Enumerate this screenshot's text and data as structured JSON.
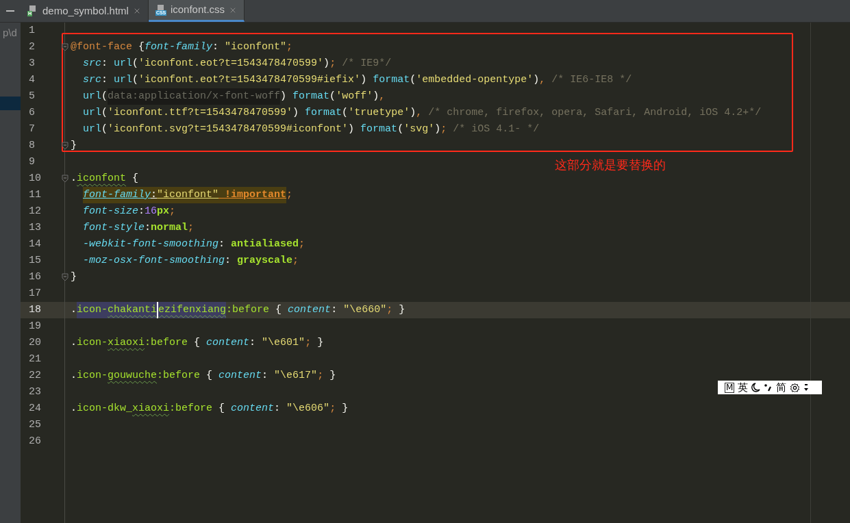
{
  "tabs": [
    {
      "label": "demo_symbol.html",
      "badge": "H",
      "color": "#499c54",
      "selected": false
    },
    {
      "label": "iconfont.css",
      "badge": "CSS",
      "color": "#3592c4",
      "selected": true
    }
  ],
  "sidebar": {
    "path_fragment": "p\\d"
  },
  "editor": {
    "lines": [
      {
        "number": "1",
        "kind": "top",
        "current": false
      },
      {
        "number": "2",
        "kind": "top",
        "current": false,
        "fold": true,
        "tokens": [
          {
            "text": "@font-face",
            "kind": "atrule"
          },
          {
            "text": " {",
            "kind": "punct"
          },
          {
            "text": "font-family",
            "kind": "prop"
          },
          {
            "text": ": ",
            "kind": "punct"
          },
          {
            "text": "\"iconfont\"",
            "kind": "str"
          },
          {
            "text": ";",
            "kind": "semi"
          }
        ]
      },
      {
        "number": "3",
        "kind": "body",
        "current": false,
        "tokens": [
          {
            "text": "src",
            "kind": "prop"
          },
          {
            "text": ": ",
            "kind": "punct"
          },
          {
            "text": "url",
            "kind": "func"
          },
          {
            "text": "(",
            "kind": "punct"
          },
          {
            "text": "'iconfont.eot?t=1543478470599'",
            "kind": "str"
          },
          {
            "text": ")",
            "kind": "punct"
          },
          {
            "text": ";",
            "kind": "semi"
          },
          {
            "text": " /* IE9*/",
            "kind": "comment"
          }
        ]
      },
      {
        "number": "4",
        "kind": "body",
        "current": false,
        "tokens": [
          {
            "text": "src",
            "kind": "prop"
          },
          {
            "text": ": ",
            "kind": "punct"
          },
          {
            "text": "url",
            "kind": "func"
          },
          {
            "text": "(",
            "kind": "punct"
          },
          {
            "text": "'iconfont.eot?t=1543478470599#iefix'",
            "kind": "str"
          },
          {
            "text": ")",
            "kind": "punct"
          },
          {
            "text": " format",
            "kind": "func"
          },
          {
            "text": "(",
            "kind": "punct"
          },
          {
            "text": "'embedded-opentype'",
            "kind": "str"
          },
          {
            "text": ")",
            "kind": "punct"
          },
          {
            "text": ",",
            "kind": "semi"
          },
          {
            "text": " /* IE6-IE8 */",
            "kind": "comment"
          }
        ]
      },
      {
        "number": "5",
        "kind": "body",
        "current": false,
        "tokens": [
          {
            "text": "url",
            "kind": "func"
          },
          {
            "text": "(",
            "kind": "punct"
          },
          {
            "text": "data:application/x-font-woff",
            "kind": "datauri"
          },
          {
            "text": ")",
            "kind": "punct"
          },
          {
            "text": " format",
            "kind": "func"
          },
          {
            "text": "(",
            "kind": "punct"
          },
          {
            "text": "'woff'",
            "kind": "str"
          },
          {
            "text": ")",
            "kind": "punct"
          },
          {
            "text": ",",
            "kind": "semi"
          }
        ]
      },
      {
        "number": "6",
        "kind": "body",
        "current": false,
        "tokens": [
          {
            "text": "url",
            "kind": "func"
          },
          {
            "text": "(",
            "kind": "punct"
          },
          {
            "text": "'iconfont.ttf?t=1543478470599'",
            "kind": "str"
          },
          {
            "text": ")",
            "kind": "punct"
          },
          {
            "text": " format",
            "kind": "func"
          },
          {
            "text": "(",
            "kind": "punct"
          },
          {
            "text": "'truetype'",
            "kind": "str"
          },
          {
            "text": ")",
            "kind": "punct"
          },
          {
            "text": ",",
            "kind": "semi"
          },
          {
            "text": " /* chrome, firefox, opera, Safari, Android, iOS 4.2+*/",
            "kind": "comment"
          }
        ]
      },
      {
        "number": "7",
        "kind": "body",
        "current": false,
        "tokens": [
          {
            "text": "url",
            "kind": "func"
          },
          {
            "text": "(",
            "kind": "punct"
          },
          {
            "text": "'iconfont.svg?t=1543478470599#iconfont'",
            "kind": "str"
          },
          {
            "text": ")",
            "kind": "punct"
          },
          {
            "text": " format",
            "kind": "func"
          },
          {
            "text": "(",
            "kind": "punct"
          },
          {
            "text": "'svg'",
            "kind": "str"
          },
          {
            "text": ")",
            "kind": "punct"
          },
          {
            "text": ";",
            "kind": "semi"
          },
          {
            "text": " /* iOS 4.1- */",
            "kind": "comment"
          }
        ]
      },
      {
        "number": "8",
        "kind": "top",
        "current": false,
        "fold": true,
        "tokens": [
          {
            "text": "}",
            "kind": "punct"
          }
        ]
      },
      {
        "number": "9",
        "kind": "top",
        "current": false
      },
      {
        "number": "10",
        "kind": "top",
        "current": false,
        "fold": true,
        "tokens": [
          {
            "text": ".",
            "kind": "punct"
          },
          {
            "text": "iconfont",
            "kind": "sel",
            "typo": true
          },
          {
            "text": " {",
            "kind": "punct"
          }
        ]
      },
      {
        "number": "11",
        "kind": "body",
        "current": false,
        "tokens": [
          {
            "text": "font-family",
            "kind": "prop",
            "marked": true
          },
          {
            "text": ":",
            "kind": "punct",
            "marked": true
          },
          {
            "text": "\"iconfont\"",
            "kind": "str",
            "marked": true
          },
          {
            "text": " !important",
            "kind": "important",
            "marked": true
          },
          {
            "text": ";",
            "kind": "semi"
          }
        ]
      },
      {
        "number": "12",
        "kind": "body",
        "current": false,
        "tokens": [
          {
            "text": "font-size",
            "kind": "prop"
          },
          {
            "text": ":",
            "kind": "punct"
          },
          {
            "text": "16",
            "kind": "number"
          },
          {
            "text": "px",
            "kind": "value"
          },
          {
            "text": ";",
            "kind": "semi"
          }
        ]
      },
      {
        "number": "13",
        "kind": "body",
        "current": false,
        "tokens": [
          {
            "text": "font-style",
            "kind": "prop"
          },
          {
            "text": ":",
            "kind": "punct"
          },
          {
            "text": "normal",
            "kind": "value"
          },
          {
            "text": ";",
            "kind": "semi"
          }
        ]
      },
      {
        "number": "14",
        "kind": "body",
        "current": false,
        "tokens": [
          {
            "text": "-webkit-font-smoothing",
            "kind": "prop"
          },
          {
            "text": ": ",
            "kind": "punct"
          },
          {
            "text": "antialiased",
            "kind": "value"
          },
          {
            "text": ";",
            "kind": "semi"
          }
        ]
      },
      {
        "number": "15",
        "kind": "body",
        "current": false,
        "tokens": [
          {
            "text": "-moz-osx-font-smoothing",
            "kind": "prop"
          },
          {
            "text": ": ",
            "kind": "punct"
          },
          {
            "text": "grayscale",
            "kind": "value"
          },
          {
            "text": ";",
            "kind": "semi"
          }
        ]
      },
      {
        "number": "16",
        "kind": "top",
        "current": false,
        "fold": true,
        "tokens": [
          {
            "text": "}",
            "kind": "punct"
          }
        ]
      },
      {
        "number": "17",
        "kind": "top",
        "current": false
      },
      {
        "number": "18",
        "kind": "top",
        "current": true,
        "tokens": [
          {
            "text": ".",
            "kind": "punct"
          },
          {
            "text": "icon-",
            "kind": "sel",
            "selected": true
          },
          {
            "text": "chakanti",
            "kind": "sel",
            "selected": true,
            "typo": true,
            "cursor": true
          },
          {
            "text": "ezifenxiang",
            "kind": "sel",
            "selected": true,
            "typo": true
          },
          {
            "text": ":before",
            "kind": "sel"
          },
          {
            "text": " { ",
            "kind": "punct"
          },
          {
            "text": "content",
            "kind": "prop"
          },
          {
            "text": ": ",
            "kind": "punct"
          },
          {
            "text": "\"\\e660\"",
            "kind": "str"
          },
          {
            "text": ";",
            "kind": "semi"
          },
          {
            "text": " }",
            "kind": "punct"
          }
        ]
      },
      {
        "number": "19",
        "kind": "top",
        "current": false
      },
      {
        "number": "20",
        "kind": "top",
        "current": false,
        "tokens": [
          {
            "text": ".",
            "kind": "punct"
          },
          {
            "text": "icon-",
            "kind": "sel"
          },
          {
            "text": "xiaoxi",
            "kind": "sel",
            "typo": true
          },
          {
            "text": ":before",
            "kind": "sel"
          },
          {
            "text": " { ",
            "kind": "punct"
          },
          {
            "text": "content",
            "kind": "prop"
          },
          {
            "text": ": ",
            "kind": "punct"
          },
          {
            "text": "\"\\e601\"",
            "kind": "str"
          },
          {
            "text": ";",
            "kind": "semi"
          },
          {
            "text": " }",
            "kind": "punct"
          }
        ]
      },
      {
        "number": "21",
        "kind": "top",
        "current": false
      },
      {
        "number": "22",
        "kind": "top",
        "current": false,
        "tokens": [
          {
            "text": ".",
            "kind": "punct"
          },
          {
            "text": "icon-",
            "kind": "sel"
          },
          {
            "text": "gouwuche",
            "kind": "sel",
            "typo": true
          },
          {
            "text": ":before",
            "kind": "sel"
          },
          {
            "text": " { ",
            "kind": "punct"
          },
          {
            "text": "content",
            "kind": "prop"
          },
          {
            "text": ": ",
            "kind": "punct"
          },
          {
            "text": "\"\\e617\"",
            "kind": "str"
          },
          {
            "text": ";",
            "kind": "semi"
          },
          {
            "text": " }",
            "kind": "punct"
          }
        ]
      },
      {
        "number": "23",
        "kind": "top",
        "current": false
      },
      {
        "number": "24",
        "kind": "top",
        "current": false,
        "tokens": [
          {
            "text": ".",
            "kind": "punct"
          },
          {
            "text": "icon-dkw_",
            "kind": "sel"
          },
          {
            "text": "xiaoxi",
            "kind": "sel",
            "typo": true
          },
          {
            "text": ":before",
            "kind": "sel"
          },
          {
            "text": " { ",
            "kind": "punct"
          },
          {
            "text": "content",
            "kind": "prop"
          },
          {
            "text": ": ",
            "kind": "punct"
          },
          {
            "text": "\"\\e606\"",
            "kind": "str"
          },
          {
            "text": ";",
            "kind": "semi"
          },
          {
            "text": " }",
            "kind": "punct"
          }
        ]
      },
      {
        "number": "25",
        "kind": "top",
        "current": false
      },
      {
        "number": "26",
        "kind": "top",
        "current": false
      }
    ]
  },
  "annotation": {
    "text": "这部分就是要替换的"
  },
  "ime_toolbar": {
    "mode_key": "M",
    "language": "英",
    "script": "简"
  }
}
